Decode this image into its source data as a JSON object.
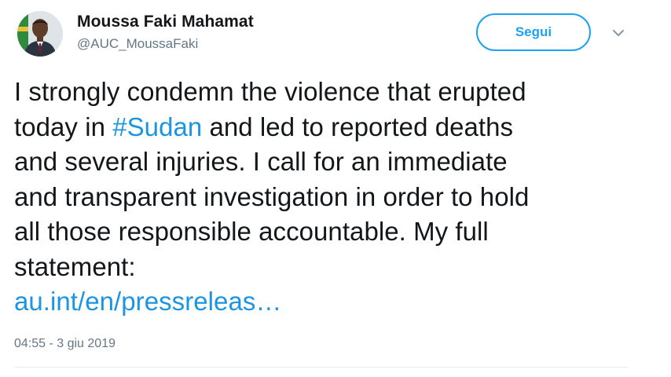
{
  "author": {
    "name": "Moussa Faki Mahamat",
    "handle": "@AUC_MoussaFaki"
  },
  "follow_button": {
    "label": "Segui"
  },
  "tweet": {
    "line1": "I strongly condemn the violence that erupted",
    "line2_prefix": "today in ",
    "hashtag": "#Sudan",
    "line2_suffix": " and led to reported deaths",
    "line3": "and several injuries. I call for an immediate",
    "line4": "and transparent investigation in order to hold",
    "line5": "all those responsible accountable. My full",
    "line6": "statement:",
    "link": "au.int/en/pressreleas…"
  },
  "timestamp": "04:55 - 3 giu 2019",
  "colors": {
    "accent": "#1da1f2",
    "link": "#1b95e0",
    "text": "#14171a",
    "muted": "#657786"
  },
  "icons": {
    "avatar": "profile-photo",
    "menu": "chevron-down-icon"
  }
}
